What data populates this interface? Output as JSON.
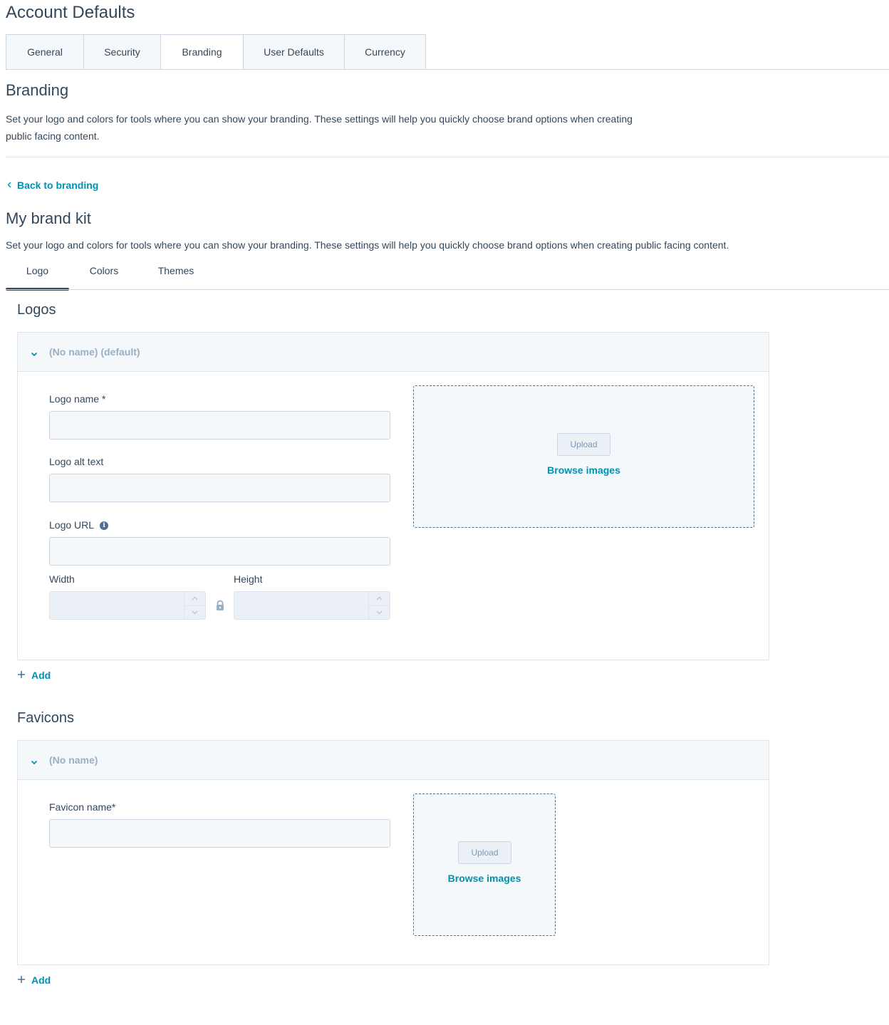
{
  "page": {
    "title": "Account Defaults"
  },
  "top_tabs": [
    {
      "label": "General"
    },
    {
      "label": "Security"
    },
    {
      "label": "Branding",
      "active": true
    },
    {
      "label": "User Defaults"
    },
    {
      "label": "Currency"
    }
  ],
  "branding": {
    "title": "Branding",
    "description": "Set your logo and colors for tools where you can show your branding. These settings will help you quickly choose brand options when creating public facing content."
  },
  "back_link": {
    "label": "Back to branding"
  },
  "brand_kit": {
    "title": "My brand kit",
    "description": "Set your logo and colors for tools where you can show your branding. These settings will help you quickly choose brand options when creating public facing content."
  },
  "sub_tabs": [
    {
      "label": "Logo",
      "active": true
    },
    {
      "label": "Colors"
    },
    {
      "label": "Themes"
    }
  ],
  "logos": {
    "title": "Logos",
    "panel_header": "(No name) (default)",
    "fields": {
      "logo_name_label": "Logo name *",
      "logo_name_value": "",
      "logo_alt_label": "Logo alt text",
      "logo_alt_value": "",
      "logo_url_label": "Logo URL",
      "logo_url_value": "",
      "width_label": "Width",
      "width_value": "",
      "height_label": "Height",
      "height_value": ""
    },
    "upload_label": "Upload",
    "browse_label": "Browse images",
    "add_label": "Add"
  },
  "favicons": {
    "title": "Favicons",
    "panel_header": "(No name)",
    "fields": {
      "favicon_name_label": "Favicon name*",
      "favicon_name_value": ""
    },
    "upload_label": "Upload",
    "browse_label": "Browse images",
    "add_label": "Add"
  },
  "colors": {
    "text": "#33475b",
    "link": "#0091ae",
    "muted": "#99afc4",
    "panel_bg": "#f5f8fa",
    "border": "#cbd6e2"
  }
}
